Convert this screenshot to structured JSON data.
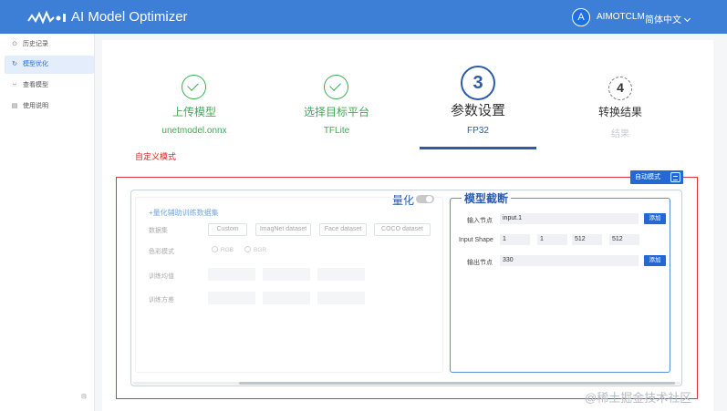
{
  "header": {
    "app_title": "AI Model Optimizer",
    "avatar_letter": "A",
    "username": "AIMOTCLM",
    "language": "简体中文"
  },
  "sidebar": {
    "items": [
      {
        "icon": "history-icon",
        "label": "历史记录"
      },
      {
        "icon": "optimize-icon",
        "label": "模型优化",
        "active": true
      },
      {
        "icon": "view-model-icon",
        "label": "查看模型"
      },
      {
        "icon": "docs-icon",
        "label": "使用说明"
      }
    ],
    "collapse_icon": "collapse-icon"
  },
  "steps": [
    {
      "number": "1",
      "title": "上传模型",
      "subtitle": "unetmodel.onnx",
      "status": "done"
    },
    {
      "number": "2",
      "title": "选择目标平台",
      "subtitle": "TFLite",
      "status": "done"
    },
    {
      "number": "3",
      "title": "参数设置",
      "subtitle": "FP32",
      "status": "current"
    },
    {
      "number": "4",
      "title": "转换结果",
      "subtitle": "结果",
      "status": "pending"
    }
  ],
  "mode_label": "自定义模式",
  "auto_mode_button": "自动模式",
  "quantization": {
    "title": "量化",
    "enabled": false,
    "dataset_link": "+量化辅助训练数据集",
    "dataset_label": "数据集",
    "datasets": [
      "Custom",
      "ImagNet dataset",
      "Face dataset",
      "COCO dataset"
    ],
    "color_label": "色彩模式",
    "color_options": [
      "RGB",
      "BGR"
    ],
    "mean_label": "训练均值",
    "std_label": "训练方差"
  },
  "truncation": {
    "title": "模型截断",
    "input_label": "输入节点",
    "input_value": "input.1",
    "input_add": "添加",
    "shape_label": "Input Shape",
    "shape_values": [
      "1",
      "1",
      "512",
      "512"
    ],
    "output_label": "输出节点",
    "output_value": "330",
    "output_add": "添加"
  },
  "watermark": "@稀土掘金技术社区",
  "colors": {
    "header_bg": "#3d7fd6",
    "success": "#3cac52",
    "primary": "#2468d4",
    "alert_red": "#d9363e"
  }
}
